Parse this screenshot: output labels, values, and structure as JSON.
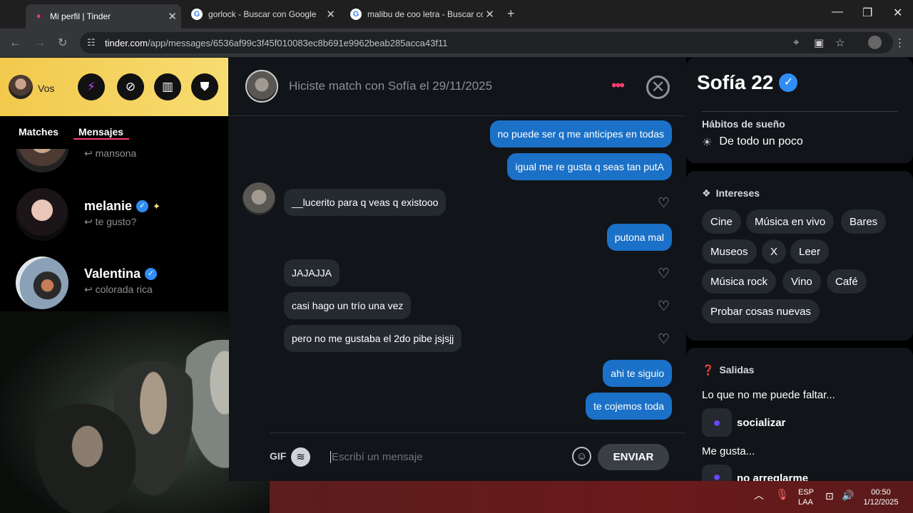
{
  "browser": {
    "tabs": [
      {
        "title": "Mi perfil | Tinder",
        "favicon": "tinder-flame-icon"
      },
      {
        "title": "gorlock - Buscar con Google",
        "favicon": "google-icon"
      },
      {
        "title": "malibu de coo letra - Buscar co",
        "favicon": "google-icon"
      }
    ],
    "new_tab": "+",
    "address": {
      "domain": "tinder.com",
      "path": "/app/messages/6536af99c3f45f010083ec8b691e9962beab285acca43f11"
    }
  },
  "profile": {
    "label": "Vos"
  },
  "left_tabs": {
    "matches": "Matches",
    "messages": "Mensajes"
  },
  "conversations": [
    {
      "name": "",
      "preview": "mansona"
    },
    {
      "name": "melanie",
      "preview": "te gusto?"
    },
    {
      "name": "Valentina",
      "preview": "colorada rica"
    }
  ],
  "chat": {
    "header": "Hiciste match con Sofía el 29/11/2025",
    "messages": [
      {
        "text": "no puede ser q me anticipes en todas",
        "from": "me"
      },
      {
        "text": "igual me re gusta q seas tan putA",
        "from": "me"
      },
      {
        "text": "__lucerito para q veas q existooo",
        "from": "them"
      },
      {
        "text": "putona mal",
        "from": "me"
      },
      {
        "text": "JAJAJJA",
        "from": "them"
      },
      {
        "text": "casi hago un trío una vez",
        "from": "them"
      },
      {
        "text": "pero no me gustaba el 2do pibe jsjsjj",
        "from": "them"
      },
      {
        "text": "ahi te siguio",
        "from": "me"
      },
      {
        "text": "te cojemos toda",
        "from": "me"
      }
    ],
    "gif": "GIF",
    "placeholder": "Escribí un mensaje",
    "send": "ENVIAR"
  },
  "sidebar": {
    "name": "Sofía 22",
    "sleep_label": "Hábitos de sueño",
    "sleep_value": "De todo un poco",
    "interests_label": "Intereses",
    "interests": [
      "Cine",
      "Música en vivo",
      "Bares",
      "Museos",
      "X",
      "Leer",
      "Música rock",
      "Vino",
      "Café",
      "Probar cosas nuevas"
    ],
    "outings_label": "Salidas",
    "must_have_label": "Lo que no me puede faltar...",
    "must_have": "socializar",
    "likes_label": "Me gusta...",
    "likes": "no arreglarme"
  },
  "taskbar": {
    "lang1": "ESP",
    "lang2": "LAA",
    "time": "00:50",
    "date": "1/12/2025"
  },
  "colors": {
    "accent": "#fe3c72",
    "bubble_me": "#1b71c7",
    "header_yellow": "#f2c94c"
  }
}
